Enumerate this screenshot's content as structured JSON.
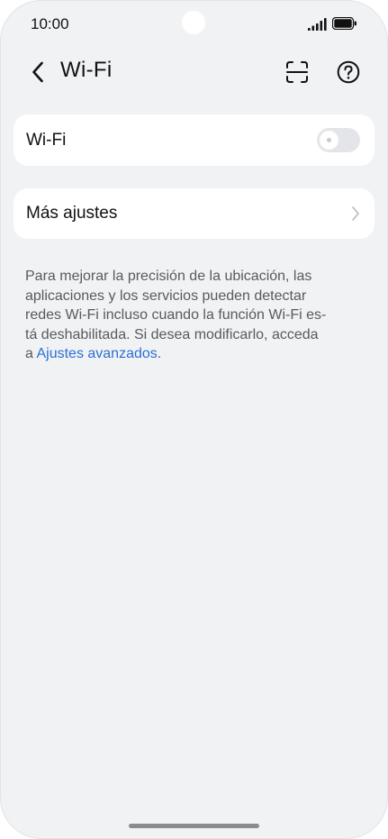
{
  "status_bar": {
    "time": "10:00"
  },
  "header": {
    "title": "Wi-Fi",
    "back_icon": "chevron-left-icon",
    "scan_icon": "scan-icon",
    "help_icon": "help-circle-icon"
  },
  "wifi_card": {
    "label": "Wi-Fi",
    "toggle_on": false
  },
  "more_card": {
    "label": "Más ajustes",
    "chevron_icon": "chevron-right-icon"
  },
  "description": {
    "lines": [
      "Para mejorar la precisión de la ubicación, las",
      "aplicaciones y los servicios pueden detectar",
      "redes Wi-Fi incluso cuando la función Wi-Fi es-",
      "tá deshabilitada. Si desea modificarlo, acceda"
    ],
    "last_prefix": "a ",
    "link_text": "Ajustes avanzados",
    "last_suffix": "."
  },
  "colors": {
    "background": "#f1f2f4",
    "card": "#ffffff",
    "link": "#2b6fd6",
    "text": "#111111",
    "secondary_text": "#595a5e"
  }
}
